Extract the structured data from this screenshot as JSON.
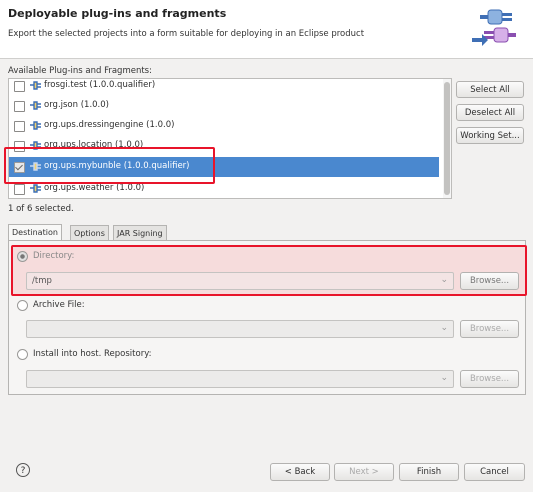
{
  "header": {
    "title": "Deployable plug-ins and fragments",
    "description": "Export the selected projects into a form suitable for deploying in an Eclipse product"
  },
  "list": {
    "label": "Available Plug-ins and Fragments:",
    "items": [
      {
        "label": "frosgi.test (1.0.0.qualifier)",
        "checked": false,
        "selected": false
      },
      {
        "label": "org.json (1.0.0)",
        "checked": false,
        "selected": false
      },
      {
        "label": "org.ups.dressingengine (1.0.0)",
        "checked": false,
        "selected": false
      },
      {
        "label": "org.ups.location (1.0.0)",
        "checked": false,
        "selected": false
      },
      {
        "label": "org.ups.mybunble (1.0.0.qualifier)",
        "checked": true,
        "selected": true
      },
      {
        "label": "org.ups.weather (1.0.0)",
        "checked": false,
        "selected": false
      }
    ],
    "status": "1 of 6 selected."
  },
  "side_buttons": {
    "select_all": "Select All",
    "deselect_all": "Deselect All",
    "working_set": "Working Set..."
  },
  "tabs": [
    "Destination",
    "Options",
    "JAR Signing"
  ],
  "destination": {
    "directory_label": "Directory:",
    "directory_value": "/tmp",
    "archive_label": "Archive File:",
    "archive_value": "",
    "install_label": "Install into host. Repository:",
    "install_value": "",
    "browse": "Browse..."
  },
  "footer": {
    "help": "?",
    "back": "< Back",
    "next": "Next >",
    "finish": "Finish",
    "cancel": "Cancel"
  },
  "colors": {
    "selection": "#4a88cf",
    "highlight_box": "#e8142a"
  }
}
